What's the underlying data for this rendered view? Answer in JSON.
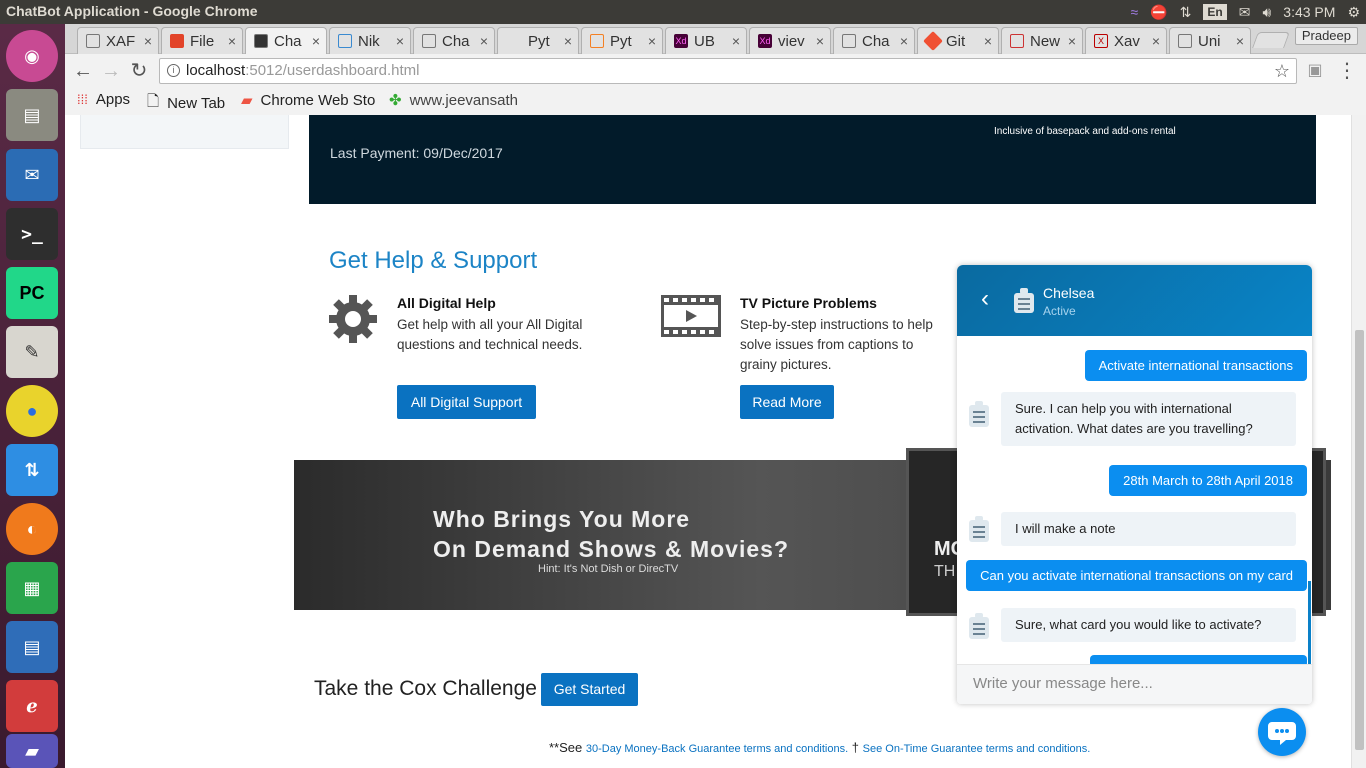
{
  "window": {
    "title": "ChatBot Application - Google Chrome"
  },
  "tray": {
    "lang": "En",
    "time": "3:43 PM"
  },
  "tabs": [
    {
      "label": "XAF"
    },
    {
      "label": "File"
    },
    {
      "label": "Cha"
    },
    {
      "label": "Nik"
    },
    {
      "label": "Cha"
    },
    {
      "label": "Pyt"
    },
    {
      "label": "Pyt"
    },
    {
      "label": "UB"
    },
    {
      "label": "viev"
    },
    {
      "label": "Cha"
    },
    {
      "label": "Git"
    },
    {
      "label": "New"
    },
    {
      "label": "Xav"
    },
    {
      "label": "Uni"
    }
  ],
  "profile": "Pradeep",
  "address": {
    "host": "localhost",
    "rest": ":5012/userdashboard.html"
  },
  "bookmarks": {
    "apps": "Apps",
    "newtab": "New Tab",
    "webstore": "Chrome Web Sto",
    "jeevan": "www.jeevansath"
  },
  "billing": {
    "last_payment": "Last Payment: 09/Dec/2017",
    "inclusive": "Inclusive of basepack and add-ons rental"
  },
  "help": {
    "title": "Get Help & Support",
    "col1": {
      "heading": "All Digital Help",
      "text": "Get help with all your All Digital questions and technical needs.",
      "button": "All Digital Support"
    },
    "col2": {
      "heading": "TV Picture Problems",
      "text": "Step-by-step instructions to help solve issues from captions to grainy pictures.",
      "button": "Read More"
    }
  },
  "banner": {
    "line1": "Who Brings You More",
    "line2": "On Demand Shows & Movies?",
    "hint": "Hint: It's Not Dish or DirecTV",
    "tv1": "MC",
    "tv2": "TH"
  },
  "cox": {
    "title": "Take the Cox Challenge",
    "button": "Get Started"
  },
  "footnote": {
    "prefix": "**See ",
    "link1": "30-Day Money-Back Guarantee terms and conditions.",
    "dagger": " † ",
    "link2": "See On-Time Guarantee terms and conditions."
  },
  "chat": {
    "agent_name": "Chelsea",
    "agent_status": "Active",
    "messages": [
      {
        "from": "user",
        "text": "Activate international transactions"
      },
      {
        "from": "bot",
        "text": "Sure. I can help you with international activation. What dates are you travelling?"
      },
      {
        "from": "user",
        "text": "28th March to 28th April 2018"
      },
      {
        "from": "bot",
        "text": "I will make a note"
      },
      {
        "from": "user",
        "text": "Can you activate international transactions on my card"
      },
      {
        "from": "bot",
        "text": "Sure, what card you would like to activate?"
      }
    ],
    "input_placeholder": "Write your message here..."
  },
  "colors": {
    "accent": "#0b8ef0",
    "heading_blue": "#1c84c6",
    "header_dark": "#021b2a"
  }
}
